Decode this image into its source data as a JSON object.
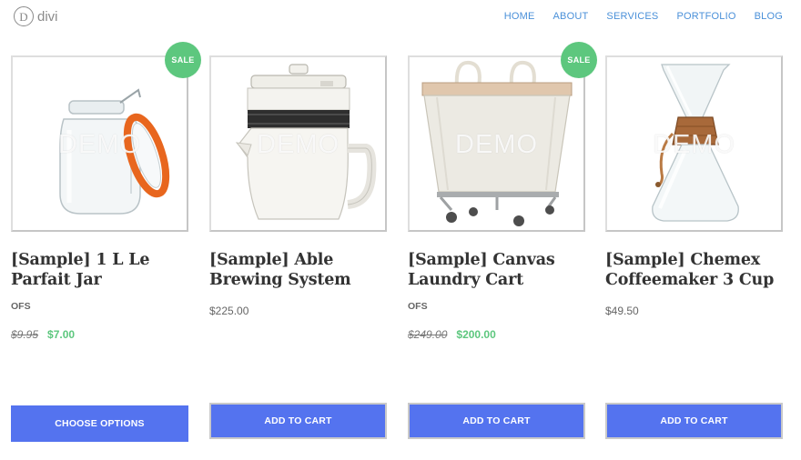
{
  "header": {
    "logo_mark": "D",
    "logo_text": "divi",
    "nav": [
      "HOME",
      "ABOUT",
      "SERVICES",
      "PORTFOLIO",
      "BLOG"
    ]
  },
  "colors": {
    "accent_button": "#5473ef",
    "sale_badge": "#5dc77e",
    "nav_link": "#4a90d9"
  },
  "products": [
    {
      "title": "[Sample] 1 L Le Parfait Jar",
      "demo_label": "DEMO",
      "sale_label": "SALE",
      "stock": "OFS",
      "old_price": "$9.95",
      "new_price": "$7.00",
      "button": "CHOOSE OPTIONS"
    },
    {
      "title": "[Sample] Able Brewing System",
      "demo_label": "DEMO",
      "price": "$225.00",
      "button": "ADD TO CART"
    },
    {
      "title": "[Sample] Canvas Laundry Cart",
      "demo_label": "DEMO",
      "sale_label": "SALE",
      "stock": "OFS",
      "old_price": "$249.00",
      "new_price": "$200.00",
      "button": "ADD TO CART"
    },
    {
      "title": "[Sample] Chemex Coffeemaker 3 Cup",
      "demo_label": "DEMO",
      "price": "$49.50",
      "button": "ADD TO CART"
    }
  ]
}
